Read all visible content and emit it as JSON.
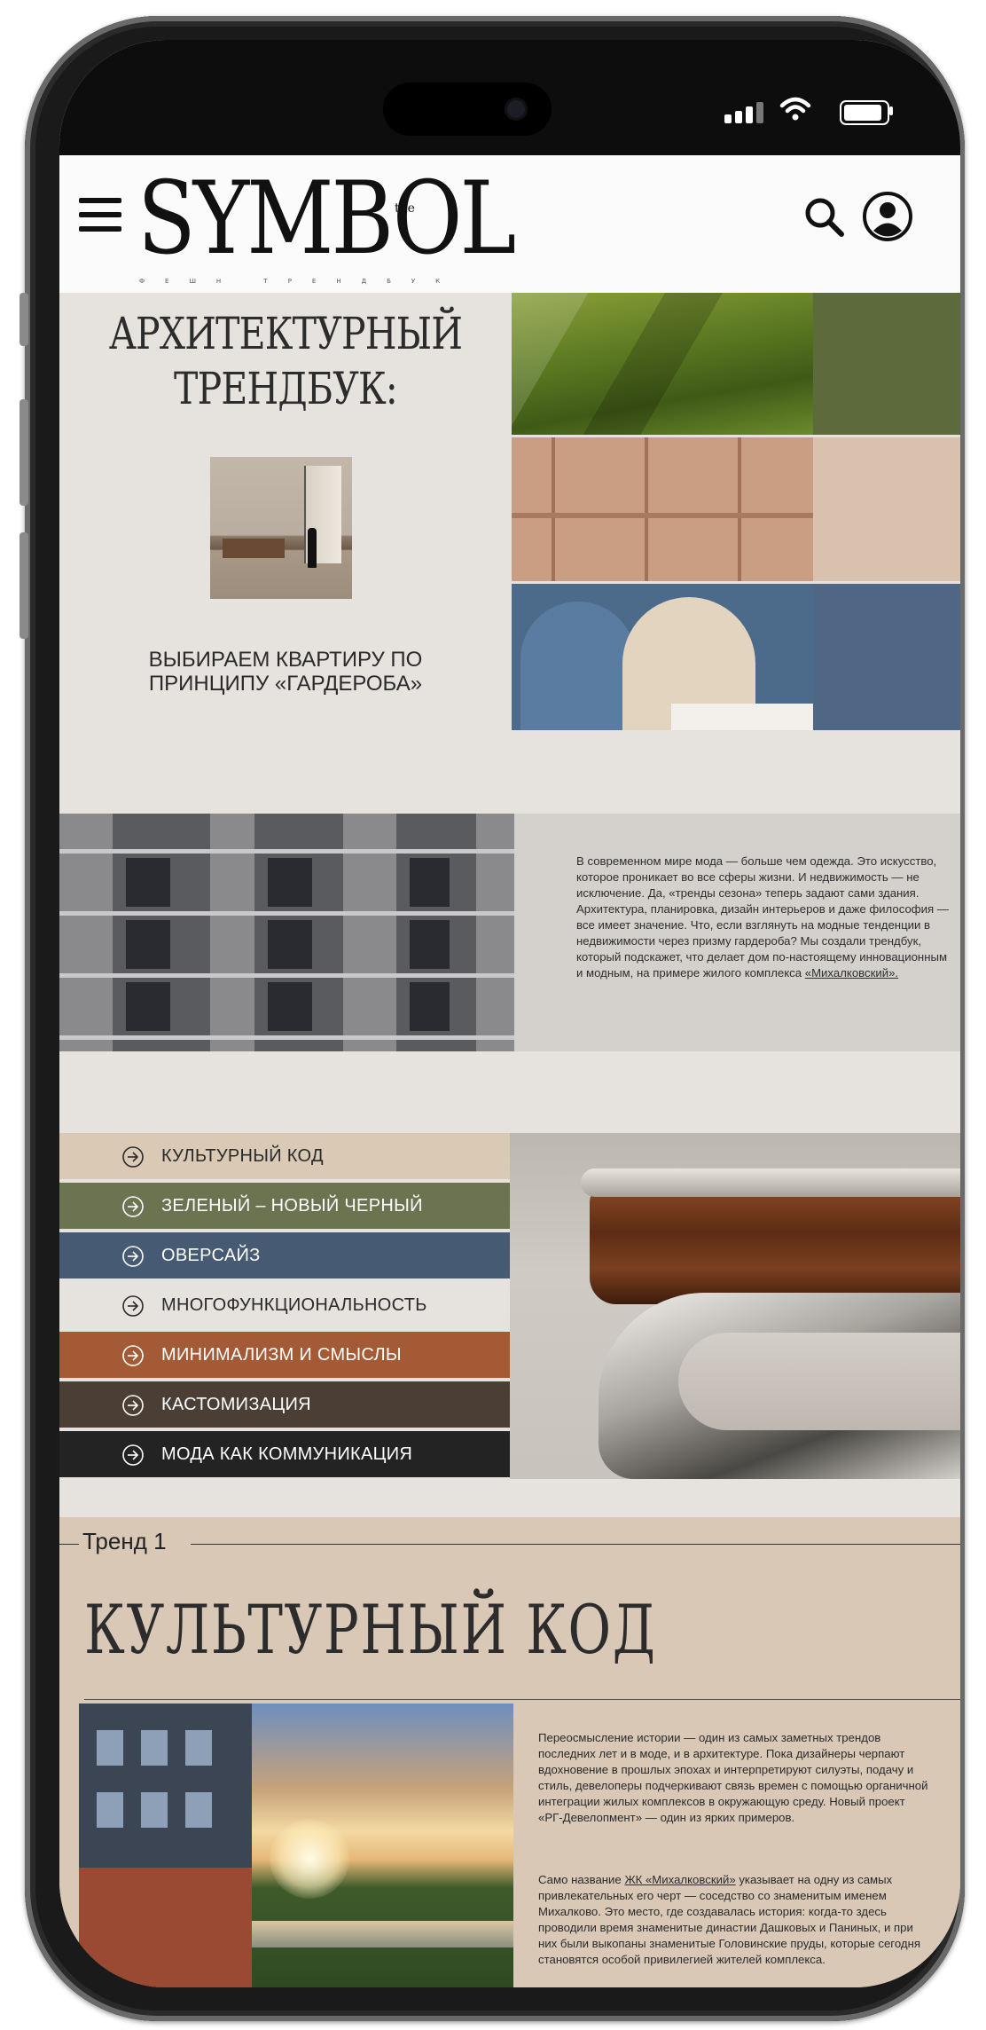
{
  "header": {
    "logo": "SYMBOL",
    "logo_the": "the",
    "logo_sub": "ФЕШН ТРЕНДБУК"
  },
  "hero": {
    "title_line1": "АРХИТЕКТУРНЫЙ",
    "title_line2": "ТРЕНДБУК:",
    "subtitle_line1": "ВЫБИРАЕМ КВАРТИРУ ПО",
    "subtitle_line2": "ПРИНЦИПУ «ГАРДЕРОБА»"
  },
  "intro": {
    "text": "В современном мире мода — больше чем одежда. Это искусство, которое проникает во все сферы жизни. И недвижимость — не исключение. Да, «тренды сезона» теперь задают сами здания. Архитектура, планировка, дизайн интерьеров и даже философия — все имеет значение. Что, если взглянуть на модные тенденции в недвижимости через призму гардероба? Мы создали трендбук, который подскажет, что делает дом по-настоящему инновационным и модным, на примере жилого комплекса ",
    "link": "«Михалковский»."
  },
  "menu": [
    {
      "label": "КУЛЬТУРНЫЙ КОД",
      "bg": "#d9c9b5",
      "color": "#2a2a2a"
    },
    {
      "label": "ЗЕЛЕНЫЙ – НОВЫЙ ЧЕРНЫЙ",
      "bg": "#6b7350",
      "color": "#ffffff"
    },
    {
      "label": "ОВЕРСАЙЗ",
      "bg": "#465a73",
      "color": "#ffffff"
    },
    {
      "label": "МНОГОФУНКЦИОНАЛЬНОСТЬ",
      "bg": "#e6e3df",
      "color": "#2a2a2a"
    },
    {
      "label": "МИНИМАЛИЗМ И СМЫСЛЫ",
      "bg": "#a35a35",
      "color": "#ffffff"
    },
    {
      "label": "КАСТОМИЗАЦИЯ",
      "bg": "#4a3e35",
      "color": "#ffffff"
    },
    {
      "label": "МОДА КАК КОММУНИКАЦИЯ",
      "bg": "#232323",
      "color": "#ffffff"
    }
  ],
  "trend": {
    "label": "Тренд 1",
    "title": "КУЛЬТУРНЫЙ КОД",
    "p1": "Переосмысление истории — один из самых заметных трендов последних лет и в моде, и в архитектуре. Пока дизайнеры черпают вдохновение в прошлых эпохах и интерпретируют силуэты, подачу и стиль, девелоперы подчеркивают связь времен с помощью органичной интеграции жилых комплексов в окружающую среду. Новый проект «РГ-Девелопмент» — один из ярких примеров.",
    "p2_before": "Само название ",
    "p2_link": "ЖК «Михалковский»",
    "p2_after": " указывает на одну из самых привлекательных его черт — соседство со знаменитым именем Михалково. Это место, где создавалась история: когда-то здесь проводили время знаменитые династии Дашковых и Паниных, и при них были выкопаны знаменитые Головинские пруды, которые сегодня становятся особой привилегией жителей комплекса."
  }
}
